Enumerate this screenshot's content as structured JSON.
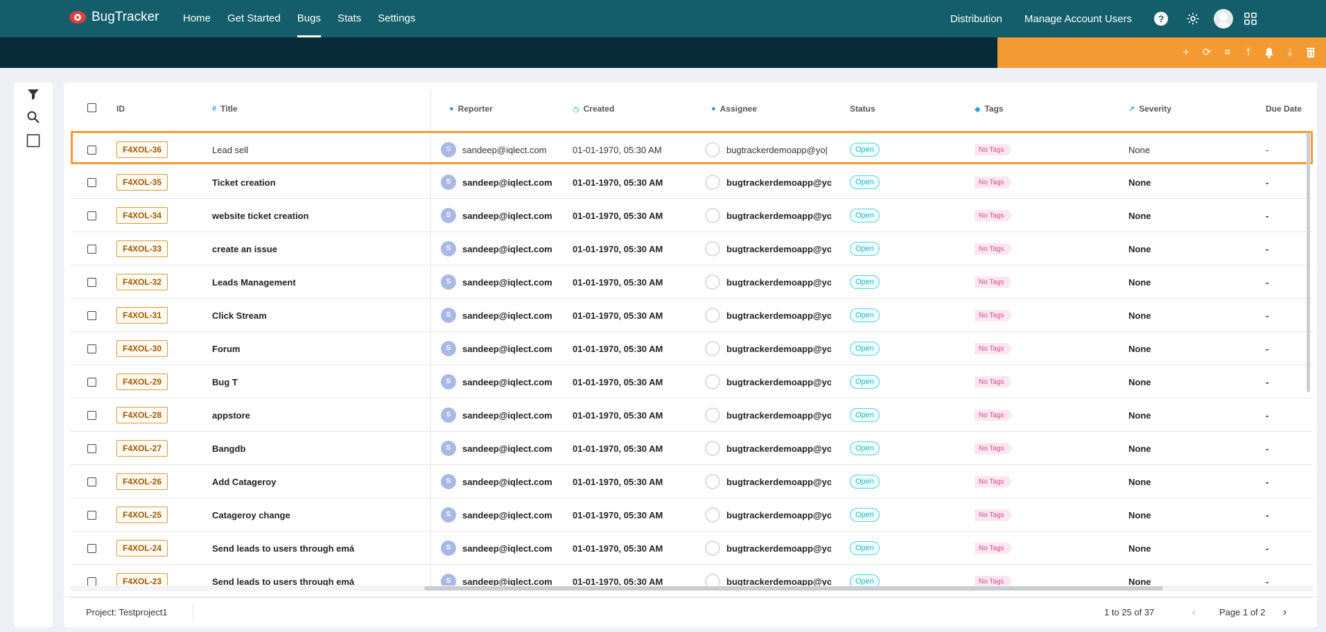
{
  "app": {
    "name": "BugTracker",
    "nav": [
      "Home",
      "Get Started",
      "Bugs",
      "Stats",
      "Settings"
    ],
    "active_nav": "Bugs",
    "right_links": [
      "Distribution",
      "Manage Account Users"
    ],
    "help_label": "?"
  },
  "toolbar": {
    "actions": [
      "add-icon",
      "refresh-icon",
      "customize-icon",
      "upload-icon",
      "bell-icon",
      "download-icon",
      "delete-icon"
    ],
    "glyphs": [
      "+",
      "⟳",
      "≡",
      "⤒",
      "🔔",
      "⤓",
      "🗑"
    ]
  },
  "colors": {
    "nav_bg": "#145e6b",
    "subbar_bg": "#062a38",
    "accent": "#f39a32",
    "status_open": "#19b8c1",
    "tag": "#d24d8d"
  },
  "table": {
    "columns": {
      "id": "ID",
      "title": "Title",
      "reporter": "Reporter",
      "created": "Created",
      "assignee": "Assignee",
      "status": "Status",
      "tags": "Tags",
      "severity": "Severity",
      "due_date": "Due Date"
    },
    "rows": [
      {
        "id": "F4XOL-36",
        "title": "Lead sell",
        "reporter": "sandeep@iqlect.com",
        "reporter_initial": "S",
        "created": "01-01-1970, 05:30 AM",
        "assignee": "bugtrackerdemoapp@yo|",
        "status": "Open",
        "tags": "No Tags",
        "severity": "None",
        "due": "-"
      },
      {
        "id": "F4XOL-35",
        "title": "Ticket creation",
        "reporter": "sandeep@iqlect.com",
        "reporter_initial": "S",
        "created": "01-01-1970, 05:30 AM",
        "assignee": "bugtrackerdemoapp@yo",
        "status": "Open",
        "tags": "No Tags",
        "severity": "None",
        "due": "-"
      },
      {
        "id": "F4XOL-34",
        "title": "website ticket creation",
        "reporter": "sandeep@iqlect.com",
        "reporter_initial": "S",
        "created": "01-01-1970, 05:30 AM",
        "assignee": "bugtrackerdemoapp@yo",
        "status": "Open",
        "tags": "No Tags",
        "severity": "None",
        "due": "-"
      },
      {
        "id": "F4XOL-33",
        "title": "create an issue",
        "reporter": "sandeep@iqlect.com",
        "reporter_initial": "S",
        "created": "01-01-1970, 05:30 AM",
        "assignee": "bugtrackerdemoapp@yo",
        "status": "Open",
        "tags": "No Tags",
        "severity": "None",
        "due": "-"
      },
      {
        "id": "F4XOL-32",
        "title": "Leads Management",
        "reporter": "sandeep@iqlect.com",
        "reporter_initial": "S",
        "created": "01-01-1970, 05:30 AM",
        "assignee": "bugtrackerdemoapp@yo",
        "status": "Open",
        "tags": "No Tags",
        "severity": "None",
        "due": "-"
      },
      {
        "id": "F4XOL-31",
        "title": "Click Stream",
        "reporter": "sandeep@iqlect.com",
        "reporter_initial": "S",
        "created": "01-01-1970, 05:30 AM",
        "assignee": "bugtrackerdemoapp@yo",
        "status": "Open",
        "tags": "No Tags",
        "severity": "None",
        "due": "-"
      },
      {
        "id": "F4XOL-30",
        "title": "Forum",
        "reporter": "sandeep@iqlect.com",
        "reporter_initial": "S",
        "created": "01-01-1970, 05:30 AM",
        "assignee": "bugtrackerdemoapp@yo",
        "status": "Open",
        "tags": "No Tags",
        "severity": "None",
        "due": "-"
      },
      {
        "id": "F4XOL-29",
        "title": "Bug T",
        "reporter": "sandeep@iqlect.com",
        "reporter_initial": "S",
        "created": "01-01-1970, 05:30 AM",
        "assignee": "bugtrackerdemoapp@yo",
        "status": "Open",
        "tags": "No Tags",
        "severity": "None",
        "due": "-"
      },
      {
        "id": "F4XOL-28",
        "title": "appstore",
        "reporter": "sandeep@iqlect.com",
        "reporter_initial": "S",
        "created": "01-01-1970, 05:30 AM",
        "assignee": "bugtrackerdemoapp@yo",
        "status": "Open",
        "tags": "No Tags",
        "severity": "None",
        "due": "-"
      },
      {
        "id": "F4XOL-27",
        "title": "Bangdb",
        "reporter": "sandeep@iqlect.com",
        "reporter_initial": "S",
        "created": "01-01-1970, 05:30 AM",
        "assignee": "bugtrackerdemoapp@yo",
        "status": "Open",
        "tags": "No Tags",
        "severity": "None",
        "due": "-"
      },
      {
        "id": "F4XOL-26",
        "title": "Add Catageroy",
        "reporter": "sandeep@iqlect.com",
        "reporter_initial": "S",
        "created": "01-01-1970, 05:30 AM",
        "assignee": "bugtrackerdemoapp@yo",
        "status": "Open",
        "tags": "No Tags",
        "severity": "None",
        "due": "-"
      },
      {
        "id": "F4XOL-25",
        "title": "Catageroy change",
        "reporter": "sandeep@iqlect.com",
        "reporter_initial": "S",
        "created": "01-01-1970, 05:30 AM",
        "assignee": "bugtrackerdemoapp@yo",
        "status": "Open",
        "tags": "No Tags",
        "severity": "None",
        "due": "-"
      },
      {
        "id": "F4XOL-24",
        "title": "Send leads to users through emá",
        "reporter": "sandeep@iqlect.com",
        "reporter_initial": "S",
        "created": "01-01-1970, 05:30 AM",
        "assignee": "bugtrackerdemoapp@yo",
        "status": "Open",
        "tags": "No Tags",
        "severity": "None",
        "due": "-"
      },
      {
        "id": "F4XOL-23",
        "title": "Send leads to users through emá",
        "reporter": "sandeep@iqlect.com",
        "reporter_initial": "S",
        "created": "01-01-1970, 05:30 AM",
        "assignee": "bugtrackerdemoapp@yo",
        "status": "Open",
        "tags": "No Tags",
        "severity": "None",
        "due": "-"
      }
    ]
  },
  "footer": {
    "project": "Project: Testproject1",
    "range": "1 to 25 of 37",
    "page": "Page 1 of 2",
    "prev": "‹",
    "next": "›"
  }
}
